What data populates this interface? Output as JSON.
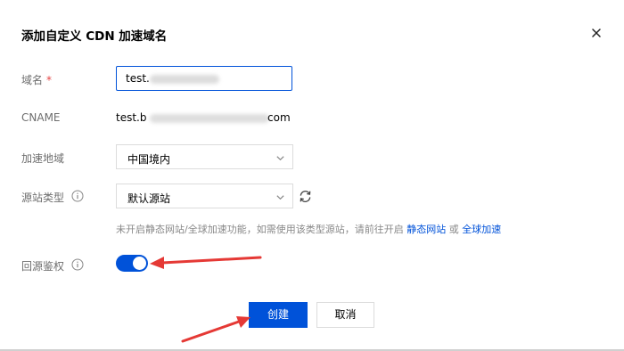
{
  "dialog": {
    "title": "添加自定义 CDN 加速域名",
    "close_icon": "close-icon"
  },
  "form": {
    "domain": {
      "label": "域名",
      "required_mark": "*",
      "value": "test."
    },
    "cname": {
      "label": "CNAME",
      "value_start": "test.b",
      "value_end": "com"
    },
    "region": {
      "label": "加速地域",
      "selected": "中国境内"
    },
    "origin_type": {
      "label": "源站类型",
      "selected": "默认源站",
      "hint_text": "未开启静态网站/全球加速功能，如需使用该类型源站，请前往开启",
      "link1": "静态网站",
      "separator": "或",
      "link2": "全球加速"
    },
    "origin_auth": {
      "label": "回源鉴权",
      "enabled": true
    }
  },
  "buttons": {
    "create": "创建",
    "cancel": "取消"
  },
  "colors": {
    "primary": "#0052d9",
    "annotation_arrow": "#e53935",
    "required": "#e54545"
  }
}
